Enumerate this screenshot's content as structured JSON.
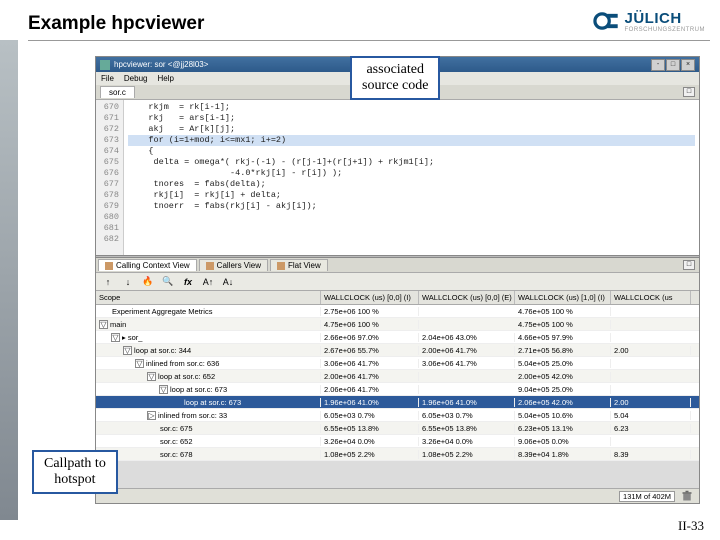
{
  "slide": {
    "title": "Example hpcviewer",
    "page_number": "II-33",
    "callout_source": "associated source code",
    "callout_callpath": "Callpath to hotspot"
  },
  "logo": {
    "name": "JÜLICH",
    "sub": "FORSCHUNGSZENTRUM"
  },
  "window": {
    "title": "hpcviewer: sor <@jj28l03>",
    "min": "-",
    "max": "□",
    "close": "×"
  },
  "menu": {
    "file": "File",
    "debug": "Debug",
    "help": "Help"
  },
  "source": {
    "tab": "sor.c",
    "lines": [
      "670",
      "671",
      "672",
      "673",
      "674",
      "675",
      "676",
      "677",
      "678",
      "679",
      "680",
      "681",
      "682"
    ],
    "code": [
      "    rkjm  = rk[i-1];",
      "    rkj   = ars[i-1];",
      "    akj   = Ar[k][j];",
      "    for (i=1+mod; i<=mx1; i+=2)",
      "    {",
      "     delta = omega*( rkj-(-1) - (r[j-1]+(r[j+1]) + rkjm1[i];",
      "                    -4.0*rkj[i] - r[i]) );",
      "",
      "     tnores  = fabs(delta);",
      "",
      "     rkj[i]  = rkj[i] + delta;",
      "",
      "     tnoerr  = fabs(rkj[i] - akj[i]);"
    ],
    "highlight_index": 3
  },
  "views": {
    "tab1": "Calling Context View",
    "tab2": "Callers View",
    "tab3": "Flat View"
  },
  "columns": {
    "scope": "Scope",
    "m1": "WALLCLOCK (us) [0,0] (I)",
    "m2": "WALLCLOCK (us) [0,0] (E)",
    "m3": "WALLCLOCK (us) [1,0] (I)",
    "m4": "WALLCLOCK (us"
  },
  "rows": [
    {
      "depth": 0,
      "exp": "",
      "name": "Experiment Aggregate Metrics",
      "m1": "2.75e+06 100 %",
      "m2": "",
      "m3": "4.76e+05 100 %",
      "m4": ""
    },
    {
      "depth": 0,
      "exp": "▽",
      "name": "main",
      "m1": "4.75e+06 100 %",
      "m2": "",
      "m3": "4.75e+05 100 %",
      "m4": ""
    },
    {
      "depth": 1,
      "exp": "▽",
      "name": "▸ sor_",
      "m1": "2.66e+06 97.0%",
      "m2": "2.04e+06 43.0%",
      "m3": "4.66e+05 97.9%",
      "m4": ""
    },
    {
      "depth": 2,
      "exp": "▽",
      "name": "loop at sor.c: 344",
      "m1": "2.67e+06 55.7%",
      "m2": "2.00e+06 41.7%",
      "m3": "2.71e+05 56.8%",
      "m4": "2.00"
    },
    {
      "depth": 3,
      "exp": "▽",
      "name": "inlined from sor.c: 636",
      "m1": "3.06e+06 41.7%",
      "m2": "3.06e+06 41.7%",
      "m3": "5.04e+05 25.0%",
      "m4": ""
    },
    {
      "depth": 4,
      "exp": "▽",
      "name": "loop at sor.c: 652",
      "m1": "2.00e+06 41.7%",
      "m2": "",
      "m3": "2.00e+05 42.0%",
      "m4": ""
    },
    {
      "depth": 5,
      "exp": "▽",
      "name": "loop at sor.c: 673",
      "m1": "2.06e+06 41.7%",
      "m2": "",
      "m3": "9.04e+05 25.0%",
      "m4": ""
    },
    {
      "depth": 6,
      "exp": "",
      "name": "loop at sor.c: 673",
      "m1": "1.96e+06 41.0%",
      "m2": "1.96e+06 41.0%",
      "m3": "2.06e+05 42.0%",
      "m4": "2.00",
      "sel": true
    },
    {
      "depth": 4,
      "exp": "▷",
      "name": "inlined from sor.c: 33",
      "m1": "6.05e+03  0.7%",
      "m2": "6.05e+03  0.7%",
      "m3": "5.04e+05 10.6%",
      "m4": "5.04"
    },
    {
      "depth": 4,
      "exp": "",
      "name": "sor.c: 675",
      "m1": "6.55e+05 13.8%",
      "m2": "6.55e+05 13.8%",
      "m3": "6.23e+05 13.1%",
      "m4": "6.23"
    },
    {
      "depth": 4,
      "exp": "",
      "name": "sor.c: 652",
      "m1": "3.26e+04  0.0%",
      "m2": "3.26e+04  0.0%",
      "m3": "9.06e+05  0.0%",
      "m4": ""
    },
    {
      "depth": 4,
      "exp": "",
      "name": "sor.c: 678",
      "m1": "1.08e+05  2.2%",
      "m2": "1.08e+05  2.2%",
      "m3": "8.39e+04  1.8%",
      "m4": "8.39"
    }
  ],
  "status": {
    "memory": "131M of 402M"
  },
  "toolbar": {
    "up": "↑",
    "down": "↓",
    "flame": "🔥",
    "zoom": "🔍",
    "fx": "fx",
    "font_inc": "A↑",
    "font_dec": "A↓"
  }
}
